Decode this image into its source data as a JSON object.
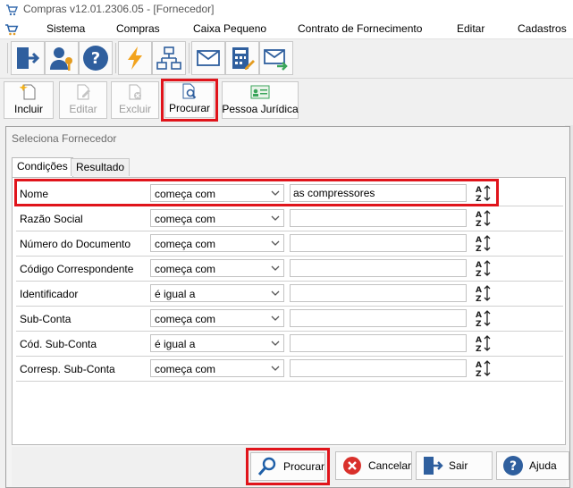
{
  "window": {
    "title": "Compras v12.01.2306.05 - [Fornecedor]"
  },
  "menu": [
    "Sistema",
    "Compras",
    "Caixa Pequeno",
    "Contrato de Fornecimento",
    "Editar",
    "Cadastros"
  ],
  "toolbar": {
    "icons": [
      "exit-icon",
      "user-key-icon",
      "help-icon",
      "lightning-icon",
      "hierarchy-icon",
      "mail-icon",
      "calculator-icon",
      "mail-forward-icon"
    ]
  },
  "actions": {
    "incluir": "Incluir",
    "editar": "Editar",
    "excluir": "Excluir",
    "procurar": "Procurar",
    "pessoa_juridica": "Pessoa Jurídica"
  },
  "dialog": {
    "title": "Seleciona Fornecedor",
    "tabs": [
      "Condições",
      "Resultado"
    ],
    "conditions": [
      {
        "label": "Nome",
        "operator": "começa com",
        "value": "as compressores"
      },
      {
        "label": "Razão Social",
        "operator": "começa com",
        "value": ""
      },
      {
        "label": "Número do Documento",
        "operator": "começa com",
        "value": ""
      },
      {
        "label": "Código Correspondente",
        "operator": "começa com",
        "value": ""
      },
      {
        "label": "Identificador",
        "operator": "é igual a",
        "value": ""
      },
      {
        "label": "Sub-Conta",
        "operator": "começa com",
        "value": ""
      },
      {
        "label": "Cód. Sub-Conta",
        "operator": "é igual a",
        "value": ""
      },
      {
        "label": "Corresp. Sub-Conta",
        "operator": "começa com",
        "value": ""
      }
    ],
    "buttons": {
      "procurar": "Procurar",
      "cancelar": "Cancelar",
      "sair": "Sair",
      "ajuda": "Ajuda"
    }
  },
  "colors": {
    "highlight": "#e0141b",
    "accent": "#1e5fa8"
  }
}
